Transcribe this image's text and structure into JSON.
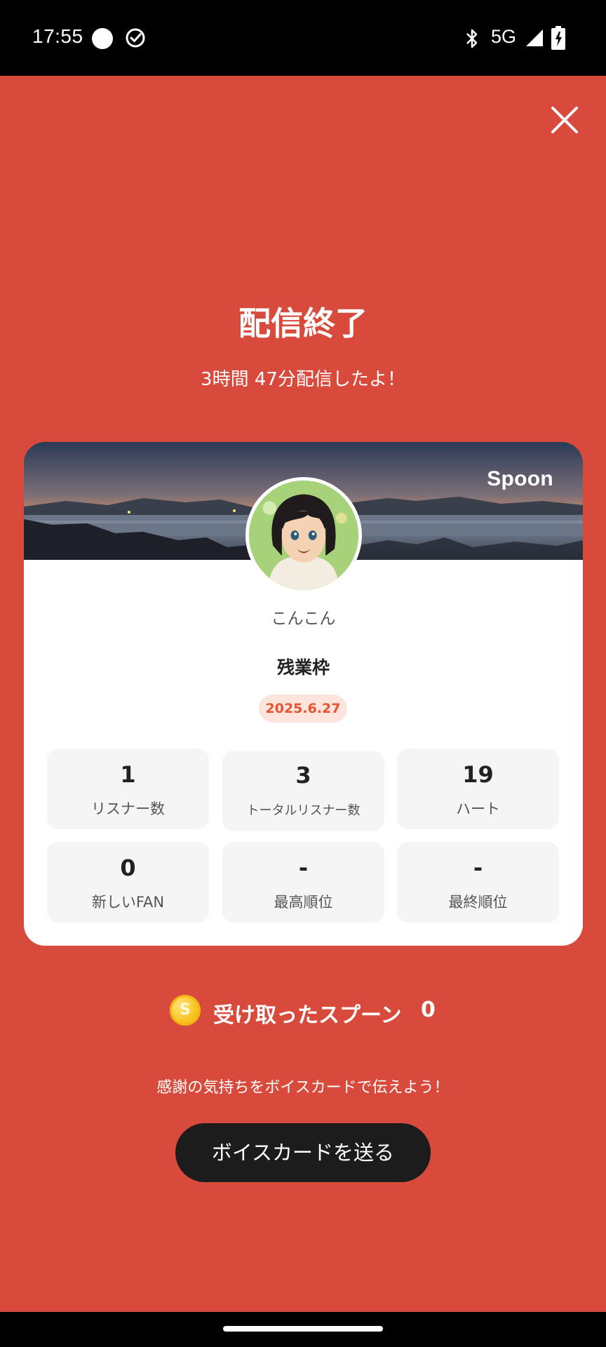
{
  "status_bar": {
    "time": "17:55",
    "network": "5G",
    "icons": [
      "circle-icon",
      "check-circle-icon",
      "bluetooth-icon",
      "signal-icon",
      "battery-charging-icon"
    ]
  },
  "header": {
    "close_icon": "close-icon",
    "title": "配信終了",
    "subtitle": "3時間 47分配信したよ！"
  },
  "card": {
    "brand": "Spoon",
    "username": "こんこん",
    "room_title": "残業枠",
    "date": "2025.6.27",
    "stats": [
      {
        "value": "1",
        "label": "リスナー数"
      },
      {
        "value": "3",
        "label": "トータルリスナー数"
      },
      {
        "value": "19",
        "label": "ハート"
      },
      {
        "value": "0",
        "label": "新しいFAN"
      },
      {
        "value": "-",
        "label": "最高順位"
      },
      {
        "value": "-",
        "label": "最終順位"
      }
    ]
  },
  "spoons": {
    "coin_symbol": "S",
    "label": "受け取ったスプーン",
    "count": "0"
  },
  "footer": {
    "thanks_text": "感謝の気持ちをボイスカードで伝えよう！",
    "voice_card_button": "ボイスカードを送る"
  },
  "colors": {
    "background": "#d84a3b",
    "card": "#ffffff",
    "date_pill_bg": "#fde4dc",
    "date_pill_text": "#e8542f",
    "button_bg": "#1c1c1c"
  }
}
